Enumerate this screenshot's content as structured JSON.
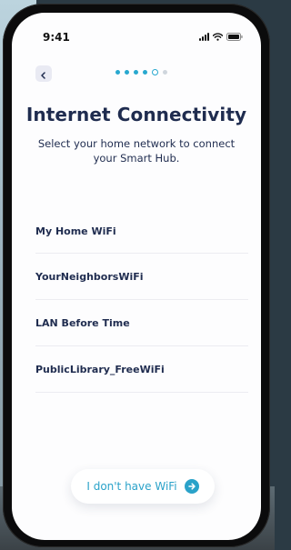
{
  "status_bar": {
    "time": "9:41"
  },
  "onboarding": {
    "step_count": 6,
    "current_step": 5
  },
  "header": {
    "title": "Internet Connectivity",
    "subtitle": "Select your home network to connect your Smart Hub."
  },
  "networks": [
    {
      "name": "My Home WiFi"
    },
    {
      "name": "YourNeighborsWiFi"
    },
    {
      "name": "LAN Before Time"
    },
    {
      "name": "PublicLibrary_FreeWiFi"
    }
  ],
  "footer": {
    "no_wifi_label": "I don't have WiFi"
  },
  "colors": {
    "accent": "#2aa2c9",
    "title": "#1f2c4f",
    "pending_dot": "#cfd6dd"
  },
  "icons": {
    "back": "chevron-left-icon",
    "no_wifi_arrow": "arrow-right-icon",
    "signal": "cellular-signal-icon",
    "wifi": "wifi-icon",
    "battery": "battery-icon"
  }
}
